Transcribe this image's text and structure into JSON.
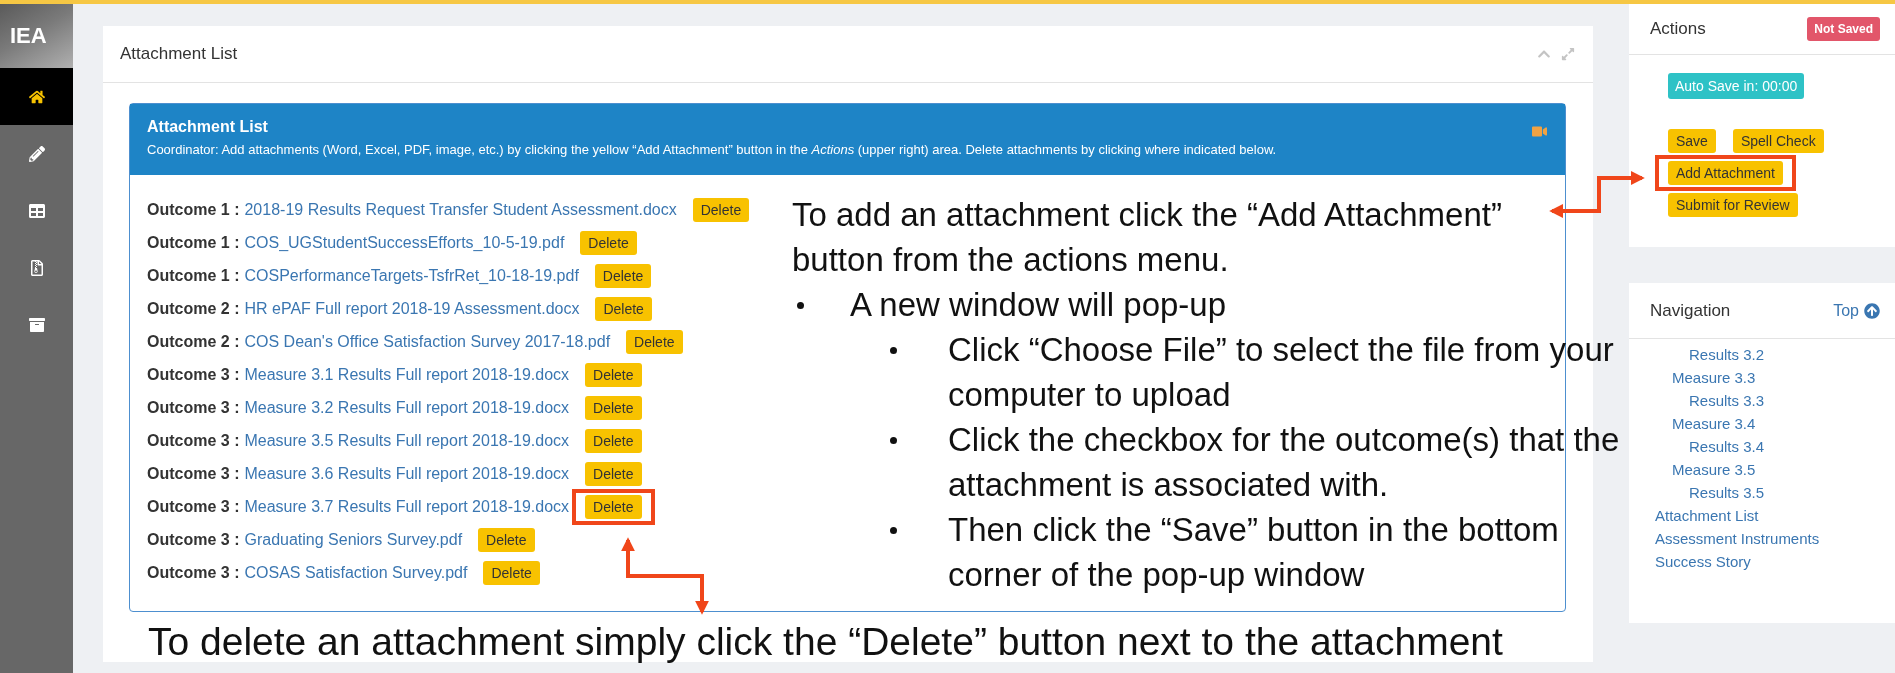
{
  "sidebar": {
    "logo": "IEA",
    "items": [
      {
        "kind": "home",
        "selected": true
      },
      {
        "kind": "pencil",
        "selected": false
      },
      {
        "kind": "table",
        "selected": false
      },
      {
        "kind": "file",
        "selected": false
      },
      {
        "kind": "archive",
        "selected": false
      }
    ]
  },
  "panel": {
    "title": "Attachment List",
    "box": {
      "title": "Attachment List",
      "description": "Coordinator: Add attachments (Word, Excel, PDF, image, etc.) by clicking the yellow “Add Attachment” button in the *Actions* (upper right) area. Delete attachments by clicking where indicated below.",
      "rows": [
        {
          "outcome": "Outcome 1 :",
          "file": "2018-19 Results Request Transfer Student Assessment.docx",
          "button": "Delete",
          "highlighted": false
        },
        {
          "outcome": "Outcome 1 :",
          "file": "COS_UGStudentSuccessEfforts_10-5-19.pdf",
          "button": "Delete",
          "highlighted": false
        },
        {
          "outcome": "Outcome 1 :",
          "file": "COSPerformanceTargets-TsfrRet_10-18-19.pdf",
          "button": "Delete",
          "highlighted": false
        },
        {
          "outcome": "Outcome 2 :",
          "file": "HR ePAF Full report 2018-19 Assessment.docx",
          "button": "Delete",
          "highlighted": false
        },
        {
          "outcome": "Outcome 2 :",
          "file": "COS Dean's Office Satisfaction Survey 2017-18.pdf",
          "button": "Delete",
          "highlighted": false
        },
        {
          "outcome": "Outcome 3 :",
          "file": "Measure 3.1 Results Full report 2018-19.docx",
          "button": "Delete",
          "highlighted": false
        },
        {
          "outcome": "Outcome 3 :",
          "file": "Measure 3.2 Results Full report 2018-19.docx",
          "button": "Delete",
          "highlighted": false
        },
        {
          "outcome": "Outcome 3 :",
          "file": "Measure 3.5 Results Full report 2018-19.docx",
          "button": "Delete",
          "highlighted": false
        },
        {
          "outcome": "Outcome 3 :",
          "file": "Measure 3.6 Results Full report 2018-19.docx",
          "button": "Delete",
          "highlighted": false
        },
        {
          "outcome": "Outcome 3 :",
          "file": "Measure 3.7 Results Full report 2018-19.docx",
          "button": "Delete",
          "highlighted": true
        },
        {
          "outcome": "Outcome 3 :",
          "file": "Graduating Seniors Survey.pdf",
          "button": "Delete",
          "highlighted": false
        },
        {
          "outcome": "Outcome 3 :",
          "file": "COSAS Satisfaction Survey.pdf",
          "button": "Delete",
          "highlighted": false
        }
      ]
    }
  },
  "actions": {
    "title": "Actions",
    "status": "Not Saved",
    "autosave": "Auto Save in: 00:00",
    "buttons": [
      {
        "label": "Save",
        "highlighted": false
      },
      {
        "label": "Spell Check",
        "highlighted": false
      },
      {
        "label": "Add Attachment",
        "highlighted": true
      },
      {
        "label": "Submit for Review",
        "highlighted": false
      }
    ]
  },
  "navigation": {
    "title": "Navigation",
    "top": "Top",
    "items": [
      {
        "children": [
          {
            "children": [
              {
                "label": "Results 3.2"
              }
            ]
          },
          {
            "label": "Measure 3.3",
            "children": [
              {
                "label": "Results 3.3"
              }
            ]
          },
          {
            "label": "Measure 3.4",
            "children": [
              {
                "label": "Results 3.4"
              }
            ]
          },
          {
            "label": "Measure 3.5",
            "children": [
              {
                "label": "Results 3.5"
              }
            ]
          }
        ]
      },
      {
        "label": "Attachment List"
      },
      {
        "label": "Assessment Instruments"
      },
      {
        "label": "Success Story"
      }
    ]
  },
  "annotations": {
    "add_note": {
      "text": "To add an attachment click the “Add Attachment” button from the actions menu.",
      "bullets": [
        {
          "text": "A new window will pop-up",
          "children": [
            {
              "text": "Click “Choose File” to select the file from your computer to upload"
            },
            {
              "text": "Click the checkbox for the outcome(s) that the attachment is associated with."
            },
            {
              "text": "Then click the “Save” button in the bottom corner of the pop-up window"
            }
          ]
        }
      ]
    },
    "delete_note": {
      "text": "To delete an attachment simply click the “Delete” button next to the attachment"
    }
  }
}
